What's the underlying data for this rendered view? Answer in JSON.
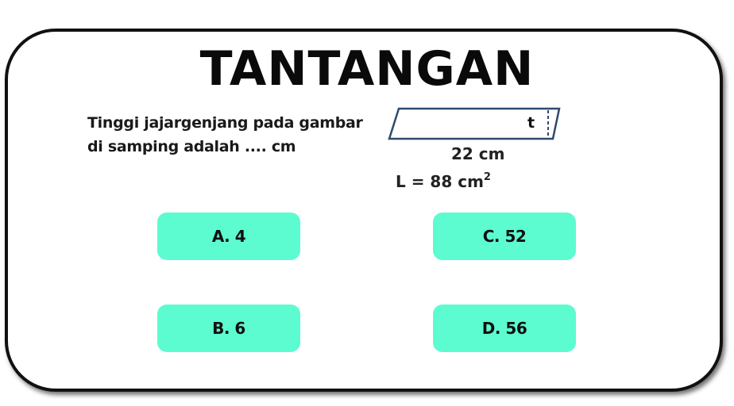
{
  "title": "TANTANGAN",
  "question": {
    "line1": "Tinggi jajargenjang pada gambar",
    "line2": "di samping adalah .... cm"
  },
  "figure": {
    "height_label": "t",
    "base_label": "22 cm",
    "area_label": "L = 88 cm",
    "area_exponent": "2",
    "stroke_color": "#2f4a6e"
  },
  "options": {
    "a": "A. 4",
    "b": "B. 6",
    "c": "C. 52",
    "d": "D. 56"
  },
  "colors": {
    "option_bg": "#5cfcd0",
    "border": "#111111"
  }
}
